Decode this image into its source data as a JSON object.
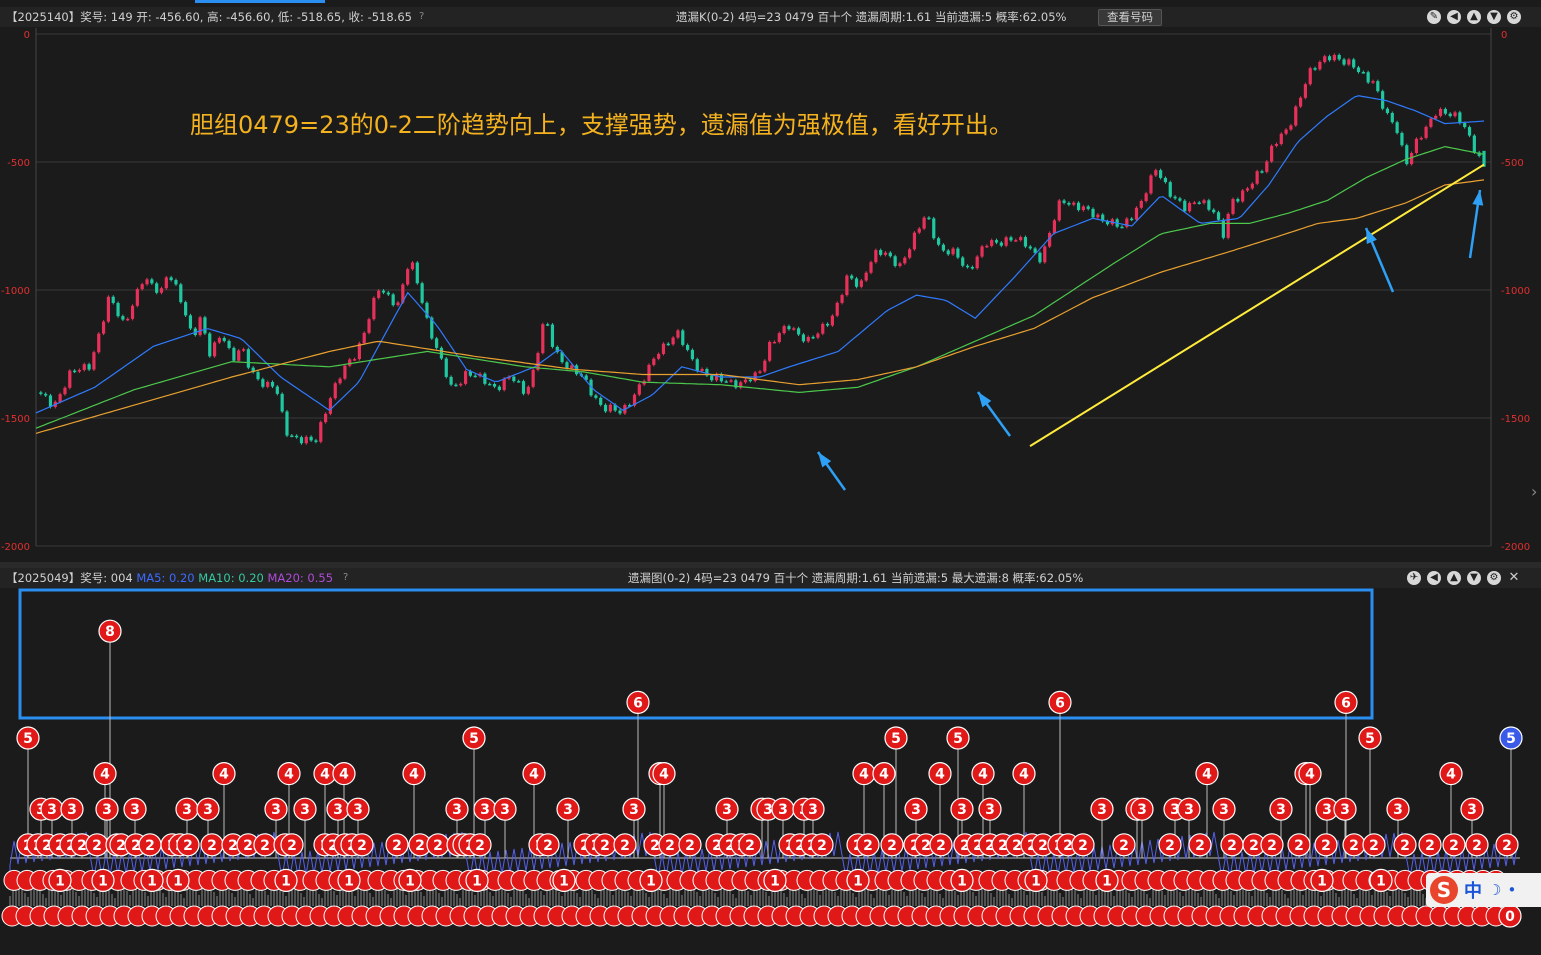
{
  "top_header": {
    "info": "【2025140】奖号: 149   开: -456.60, 高: -456.60, 低: -518.65, 收: -518.65",
    "info_help": "?",
    "center": "遗漏K(0-2)   4码=23   0479   百十个   遗漏周期:1.61   当前遗漏:5   概率:62.05%",
    "query_button": "查看号码",
    "icons": [
      "edit-icon",
      "back-icon",
      "up-icon",
      "down-icon",
      "settings-icon"
    ]
  },
  "bottom_header": {
    "prefix": "【2025049】奖号: 004 ",
    "ma5": "MA5: 0.20",
    "ma10": "MA10: 0.20",
    "ma20": "MA20: 0.55",
    "help": "?",
    "center": "遗漏图(0-2)   4码=23   0479   百十个   遗漏周期:1.61   当前遗漏:5   最大遗漏:8   概率:62.05%",
    "icons": [
      "pin-icon",
      "back-icon",
      "up-icon",
      "down-icon",
      "settings-icon",
      "close-icon"
    ]
  },
  "annotation": "胆组0479=23的0-2二阶趋势向上，支撑强势，遗漏值为强极值，看好开出。",
  "colors": {
    "up": "#e8315a",
    "down": "#1fc8a0",
    "ma5": "#2f7bff",
    "ma10": "#4cc84c",
    "ma20": "#e8a030",
    "trend": "#ffeb3b",
    "arrow": "#2ea0f5",
    "ball": "#e01818",
    "ball_current": "#3a5ae8",
    "box": "#2a8ff0",
    "annotation": "#f5b21f"
  },
  "ime": {
    "logo": "S",
    "mode": "中",
    "moon": "☽",
    "dot": "•"
  },
  "chart_data": [
    {
      "type": "candlestick",
      "title": "遗漏K(0-2)",
      "ylim": [
        -2000,
        0
      ],
      "yticks": [
        0,
        -500,
        -1000,
        -1500,
        -2000
      ],
      "yticklabels": [
        "0",
        "-500",
        "-1000",
        "-1500",
        "-2000"
      ],
      "x_count": 300,
      "last_bar": {
        "open": -456.6,
        "high": -456.6,
        "low": -518.65,
        "close": -518.65
      },
      "close_keypoints": [
        [
          0,
          -1400
        ],
        [
          18,
          -1450
        ],
        [
          35,
          -1330
        ],
        [
          55,
          -1290
        ],
        [
          68,
          -1130
        ],
        [
          75,
          -1030
        ],
        [
          90,
          -1130
        ],
        [
          110,
          -960
        ],
        [
          128,
          -1000
        ],
        [
          135,
          -930
        ],
        [
          150,
          -1060
        ],
        [
          160,
          -1180
        ],
        [
          168,
          -1110
        ],
        [
          178,
          -1260
        ],
        [
          190,
          -1160
        ],
        [
          201,
          -1270
        ],
        [
          210,
          -1230
        ],
        [
          220,
          -1320
        ],
        [
          235,
          -1370
        ],
        [
          245,
          -1380
        ],
        [
          255,
          -1550
        ],
        [
          268,
          -1580
        ],
        [
          285,
          -1600
        ],
        [
          300,
          -1420
        ],
        [
          312,
          -1330
        ],
        [
          328,
          -1240
        ],
        [
          350,
          -1000
        ],
        [
          370,
          -1050
        ],
        [
          378,
          -940
        ],
        [
          382,
          -880
        ],
        [
          392,
          -1000
        ],
        [
          400,
          -1120
        ],
        [
          415,
          -1290
        ],
        [
          425,
          -1390
        ],
        [
          440,
          -1320
        ],
        [
          455,
          -1350
        ],
        [
          470,
          -1380
        ],
        [
          485,
          -1340
        ],
        [
          500,
          -1400
        ],
        [
          508,
          -1320
        ],
        [
          515,
          -1200
        ],
        [
          520,
          -1110
        ],
        [
          530,
          -1240
        ],
        [
          545,
          -1300
        ],
        [
          560,
          -1350
        ],
        [
          570,
          -1410
        ],
        [
          580,
          -1460
        ],
        [
          598,
          -1480
        ],
        [
          620,
          -1360
        ],
        [
          637,
          -1230
        ],
        [
          655,
          -1170
        ],
        [
          672,
          -1280
        ],
        [
          690,
          -1350
        ],
        [
          705,
          -1350
        ],
        [
          722,
          -1370
        ],
        [
          738,
          -1330
        ],
        [
          750,
          -1210
        ],
        [
          770,
          -1140
        ],
        [
          790,
          -1200
        ],
        [
          800,
          -1170
        ],
        [
          815,
          -1090
        ],
        [
          830,
          -950
        ],
        [
          842,
          -990
        ],
        [
          850,
          -900
        ],
        [
          860,
          -850
        ],
        [
          875,
          -880
        ],
        [
          883,
          -900
        ],
        [
          895,
          -820
        ],
        [
          910,
          -700
        ],
        [
          925,
          -850
        ],
        [
          940,
          -860
        ],
        [
          953,
          -920
        ],
        [
          972,
          -820
        ],
        [
          995,
          -800
        ],
        [
          1012,
          -820
        ],
        [
          1028,
          -880
        ],
        [
          1048,
          -640
        ],
        [
          1072,
          -690
        ],
        [
          1090,
          -720
        ],
        [
          1110,
          -760
        ],
        [
          1130,
          -650
        ],
        [
          1145,
          -530
        ],
        [
          1160,
          -620
        ],
        [
          1175,
          -690
        ],
        [
          1190,
          -640
        ],
        [
          1205,
          -700
        ],
        [
          1213,
          -800
        ],
        [
          1222,
          -650
        ],
        [
          1240,
          -600
        ],
        [
          1255,
          -520
        ],
        [
          1265,
          -420
        ],
        [
          1280,
          -380
        ],
        [
          1290,
          -270
        ],
        [
          1300,
          -150
        ],
        [
          1315,
          -110
        ],
        [
          1325,
          -80
        ],
        [
          1340,
          -110
        ],
        [
          1355,
          -160
        ],
        [
          1367,
          -180
        ],
        [
          1380,
          -320
        ],
        [
          1392,
          -380
        ],
        [
          1400,
          -500
        ],
        [
          1410,
          -430
        ],
        [
          1420,
          -380
        ],
        [
          1432,
          -290
        ],
        [
          1448,
          -320
        ],
        [
          1460,
          -360
        ],
        [
          1470,
          -440
        ],
        [
          1480,
          -519
        ]
      ],
      "ma": {
        "ma5": [
          [
            0,
            -1480
          ],
          [
            60,
            -1380
          ],
          [
            120,
            -1220
          ],
          [
            175,
            -1150
          ],
          [
            210,
            -1190
          ],
          [
            250,
            -1340
          ],
          [
            300,
            -1470
          ],
          [
            330,
            -1360
          ],
          [
            360,
            -1150
          ],
          [
            380,
            -1010
          ],
          [
            410,
            -1140
          ],
          [
            440,
            -1310
          ],
          [
            470,
            -1360
          ],
          [
            510,
            -1300
          ],
          [
            535,
            -1230
          ],
          [
            570,
            -1390
          ],
          [
            600,
            -1470
          ],
          [
            630,
            -1410
          ],
          [
            660,
            -1300
          ],
          [
            700,
            -1340
          ],
          [
            740,
            -1340
          ],
          [
            770,
            -1300
          ],
          [
            820,
            -1240
          ],
          [
            870,
            -1080
          ],
          [
            900,
            -1020
          ],
          [
            930,
            -1040
          ],
          [
            960,
            -1110
          ],
          [
            1000,
            -950
          ],
          [
            1040,
            -780
          ],
          [
            1080,
            -720
          ],
          [
            1120,
            -750
          ],
          [
            1150,
            -630
          ],
          [
            1190,
            -740
          ],
          [
            1230,
            -720
          ],
          [
            1260,
            -590
          ],
          [
            1290,
            -420
          ],
          [
            1320,
            -320
          ],
          [
            1350,
            -240
          ],
          [
            1380,
            -260
          ],
          [
            1410,
            -300
          ],
          [
            1440,
            -350
          ],
          [
            1480,
            -340
          ]
        ],
        "ma10": [
          [
            0,
            -1540
          ],
          [
            100,
            -1390
          ],
          [
            200,
            -1280
          ],
          [
            300,
            -1300
          ],
          [
            400,
            -1240
          ],
          [
            500,
            -1300
          ],
          [
            560,
            -1320
          ],
          [
            620,
            -1360
          ],
          [
            700,
            -1370
          ],
          [
            780,
            -1400
          ],
          [
            840,
            -1380
          ],
          [
            900,
            -1300
          ],
          [
            960,
            -1200
          ],
          [
            1020,
            -1100
          ],
          [
            1060,
            -1000
          ],
          [
            1100,
            -900
          ],
          [
            1150,
            -780
          ],
          [
            1200,
            -740
          ],
          [
            1240,
            -740
          ],
          [
            1280,
            -700
          ],
          [
            1320,
            -650
          ],
          [
            1360,
            -560
          ],
          [
            1400,
            -490
          ],
          [
            1440,
            -440
          ],
          [
            1480,
            -470
          ]
        ],
        "ma20": [
          [
            0,
            -1560
          ],
          [
            100,
            -1450
          ],
          [
            200,
            -1340
          ],
          [
            300,
            -1240
          ],
          [
            350,
            -1200
          ],
          [
            450,
            -1260
          ],
          [
            550,
            -1310
          ],
          [
            620,
            -1330
          ],
          [
            700,
            -1330
          ],
          [
            780,
            -1370
          ],
          [
            840,
            -1350
          ],
          [
            900,
            -1300
          ],
          [
            960,
            -1220
          ],
          [
            1020,
            -1150
          ],
          [
            1080,
            -1030
          ],
          [
            1150,
            -930
          ],
          [
            1220,
            -850
          ],
          [
            1270,
            -790
          ],
          [
            1310,
            -740
          ],
          [
            1350,
            -720
          ],
          [
            1400,
            -660
          ],
          [
            1440,
            -590
          ],
          [
            1480,
            -570
          ]
        ]
      },
      "trendline": {
        "from": [
          1016,
          -1610
        ],
        "to": [
          1480,
          -510
        ]
      },
      "arrows": [
        "support-arrow-1",
        "support-arrow-2",
        "support-arrow-3",
        "support-arrow-4"
      ]
    },
    {
      "type": "lollipop",
      "title": "遗漏图(0-2)",
      "max_omission": 8,
      "current_omission": 5,
      "highlight_box_label": "",
      "peaks": [
        {
          "x": 28,
          "v": 5
        },
        {
          "x": 41,
          "v": 3
        },
        {
          "x": 52,
          "v": 3
        },
        {
          "x": 72,
          "v": 3
        },
        {
          "x": 105,
          "v": 4
        },
        {
          "x": 110,
          "v": 8
        },
        {
          "x": 107,
          "v": 3
        },
        {
          "x": 135,
          "v": 3
        },
        {
          "x": 187,
          "v": 3
        },
        {
          "x": 208,
          "v": 3
        },
        {
          "x": 224,
          "v": 4
        },
        {
          "x": 276,
          "v": 3
        },
        {
          "x": 289,
          "v": 4
        },
        {
          "x": 305,
          "v": 3
        },
        {
          "x": 325,
          "v": 4
        },
        {
          "x": 338,
          "v": 3
        },
        {
          "x": 344,
          "v": 4
        },
        {
          "x": 358,
          "v": 3
        },
        {
          "x": 414,
          "v": 4
        },
        {
          "x": 457,
          "v": 3
        },
        {
          "x": 474,
          "v": 5
        },
        {
          "x": 485,
          "v": 3
        },
        {
          "x": 505,
          "v": 3
        },
        {
          "x": 534,
          "v": 4
        },
        {
          "x": 568,
          "v": 3
        },
        {
          "x": 634,
          "v": 3
        },
        {
          "x": 638,
          "v": 6
        },
        {
          "x": 660,
          "v": 4
        },
        {
          "x": 664,
          "v": 4
        },
        {
          "x": 727,
          "v": 3
        },
        {
          "x": 762,
          "v": 3
        },
        {
          "x": 768,
          "v": 3
        },
        {
          "x": 783,
          "v": 3
        },
        {
          "x": 804,
          "v": 3
        },
        {
          "x": 813,
          "v": 3
        },
        {
          "x": 864,
          "v": 4
        },
        {
          "x": 884,
          "v": 4
        },
        {
          "x": 896,
          "v": 5
        },
        {
          "x": 916,
          "v": 3
        },
        {
          "x": 940,
          "v": 4
        },
        {
          "x": 958,
          "v": 5
        },
        {
          "x": 962,
          "v": 3
        },
        {
          "x": 983,
          "v": 4
        },
        {
          "x": 990,
          "v": 3
        },
        {
          "x": 1024,
          "v": 4
        },
        {
          "x": 1060,
          "v": 6
        },
        {
          "x": 1102,
          "v": 3
        },
        {
          "x": 1137,
          "v": 3
        },
        {
          "x": 1142,
          "v": 3
        },
        {
          "x": 1175,
          "v": 3
        },
        {
          "x": 1189,
          "v": 3
        },
        {
          "x": 1207,
          "v": 4
        },
        {
          "x": 1224,
          "v": 3
        },
        {
          "x": 1281,
          "v": 3
        },
        {
          "x": 1306,
          "v": 4
        },
        {
          "x": 1310,
          "v": 4
        },
        {
          "x": 1327,
          "v": 3
        },
        {
          "x": 1345,
          "v": 3
        },
        {
          "x": 1346,
          "v": 6
        },
        {
          "x": 1370,
          "v": 5
        },
        {
          "x": 1398,
          "v": 3
        },
        {
          "x": 1451,
          "v": 4
        },
        {
          "x": 1472,
          "v": 3
        }
      ],
      "twos": [
        28,
        38,
        47,
        60,
        71,
        82,
        97,
        117,
        121,
        136,
        150,
        172,
        180,
        188,
        212,
        233,
        248,
        265,
        285,
        292,
        325,
        333,
        345,
        352,
        362,
        397,
        420,
        438,
        458,
        464,
        470,
        480,
        540,
        548,
        585,
        596,
        605,
        625,
        655,
        670,
        690,
        717,
        730,
        742,
        750,
        790,
        800,
        812,
        822,
        858,
        868,
        892,
        915,
        926,
        941,
        965,
        978,
        990,
        1003,
        1017,
        1032,
        1043,
        1059,
        1068,
        1083,
        1124,
        1170,
        1200,
        1232,
        1254,
        1272,
        1299,
        1326,
        1354,
        1374,
        1405,
        1430,
        1454,
        1477,
        1507
      ],
      "ones": [
        60,
        103,
        152,
        178,
        286,
        349,
        410,
        477,
        564,
        651,
        775,
        858,
        962,
        1036,
        1107,
        1322,
        1381
      ],
      "current": {
        "x": 1511,
        "v": 5
      },
      "zero_label": "0"
    }
  ]
}
